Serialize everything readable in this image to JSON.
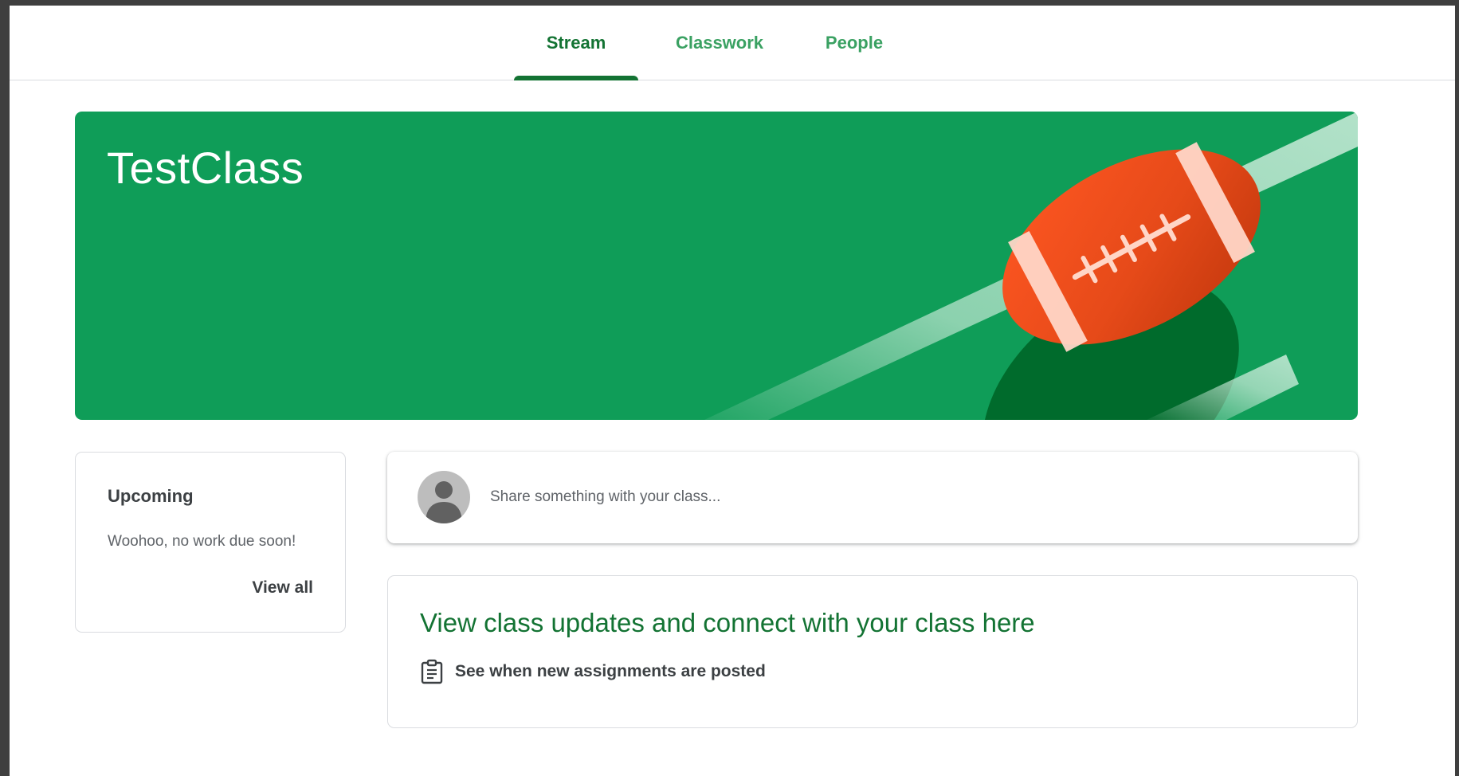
{
  "nav": {
    "tabs": [
      {
        "label": "Stream",
        "active": true
      },
      {
        "label": "Classwork",
        "active": false
      },
      {
        "label": "People",
        "active": false
      }
    ]
  },
  "banner": {
    "title": "TestClass",
    "color": "#0f9d58",
    "illustration": "american-football"
  },
  "upcoming": {
    "title": "Upcoming",
    "empty_text": "Woohoo, no work due soon!",
    "view_all": "View all"
  },
  "share": {
    "placeholder": "Share something with your class..."
  },
  "updates": {
    "title": "View class updates and connect with your class here",
    "item_icon": "assignment-clipboard-icon",
    "item_label": "See when new assignments are posted"
  },
  "colors": {
    "accent_green": "#137333",
    "tab_green": "#3aa162",
    "banner_green": "#0f9d58"
  }
}
